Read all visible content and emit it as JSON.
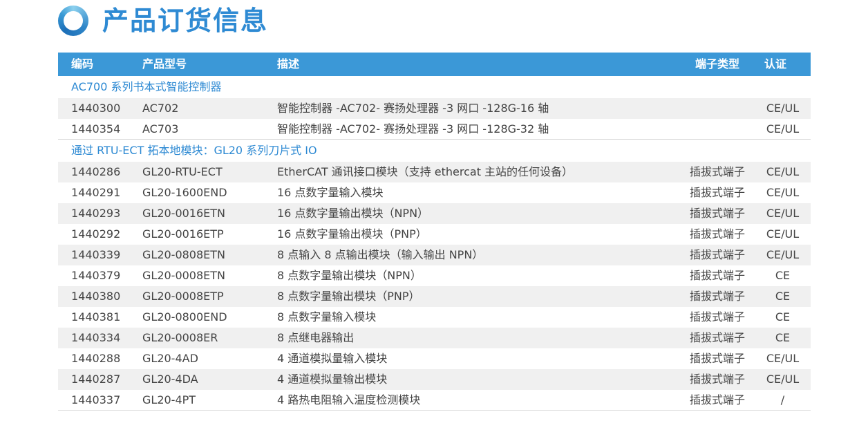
{
  "page": {
    "title": "产品订货信息",
    "accent_color": "#3b98d7",
    "title_color": "#2e8ad3",
    "title_icon": "ring-icon"
  },
  "table": {
    "headers": {
      "code": "编码",
      "model": "产品型号",
      "desc": "描述",
      "term": "端子类型",
      "cert": "认证"
    },
    "sections": [
      {
        "title": "AC700 系列书本式智能控制器",
        "rows": [
          {
            "code": "1440300",
            "model": "AC702",
            "desc": "智能控制器 -AC702- 赛扬处理器 -3 网口 -128G-16 轴",
            "term": "",
            "cert": "CE/UL"
          },
          {
            "code": "1440354",
            "model": "AC703",
            "desc": "智能控制器 -AC702- 赛扬处理器 -3 网口 -128G-32 轴",
            "term": "",
            "cert": "CE/UL"
          }
        ]
      },
      {
        "title": "通过 RTU-ECT 拓本地模块：GL20 系列刀片式 IO",
        "rows": [
          {
            "code": "1440286",
            "model": "GL20-RTU-ECT",
            "desc": "EtherCAT 通讯接口模块（支持 ethercat 主站的任何设备）",
            "term": "插拔式端子",
            "cert": "CE/UL"
          },
          {
            "code": "1440291",
            "model": "GL20-1600END",
            "desc": "16 点数字量输入模块",
            "term": "插拔式端子",
            "cert": "CE/UL"
          },
          {
            "code": "1440293",
            "model": "GL20-0016ETN",
            "desc": "16 点数字量输出模块（NPN）",
            "term": "插拔式端子",
            "cert": "CE/UL"
          },
          {
            "code": "1440292",
            "model": "GL20-0016ETP",
            "desc": "16 点数字量输出模块（PNP）",
            "term": "插拔式端子",
            "cert": "CE/UL"
          },
          {
            "code": "1440339",
            "model": "GL20-0808ETN",
            "desc": "8 点输入 8 点输出模块（输入输出 NPN）",
            "term": "插拔式端子",
            "cert": "CE/UL"
          },
          {
            "code": "1440379",
            "model": "GL20-0008ETN",
            "desc": "8 点数字量输出模块（NPN）",
            "term": "插拔式端子",
            "cert": "CE"
          },
          {
            "code": "1440380",
            "model": "GL20-0008ETP",
            "desc": "8 点数字量输出模块（PNP）",
            "term": "插拔式端子",
            "cert": "CE"
          },
          {
            "code": "1440381",
            "model": "GL20-0800END",
            "desc": "8 点数字量输入模块",
            "term": "插拔式端子",
            "cert": "CE"
          },
          {
            "code": "1440334",
            "model": "GL20-0008ER",
            "desc": "8 点继电器输出",
            "term": "插拔式端子",
            "cert": "CE"
          },
          {
            "code": "1440288",
            "model": "GL20-4AD",
            "desc": "4 通道模拟量输入模块",
            "term": "插拔式端子",
            "cert": "CE/UL"
          },
          {
            "code": "1440287",
            "model": "GL20-4DA",
            "desc": "4 通道模拟量输出模块",
            "term": "插拔式端子",
            "cert": "CE/UL"
          },
          {
            "code": "1440337",
            "model": "GL20-4PT",
            "desc": "4 路热电阻输入温度检测模块",
            "term": "插拔式端子",
            "cert": "/"
          }
        ]
      }
    ]
  }
}
